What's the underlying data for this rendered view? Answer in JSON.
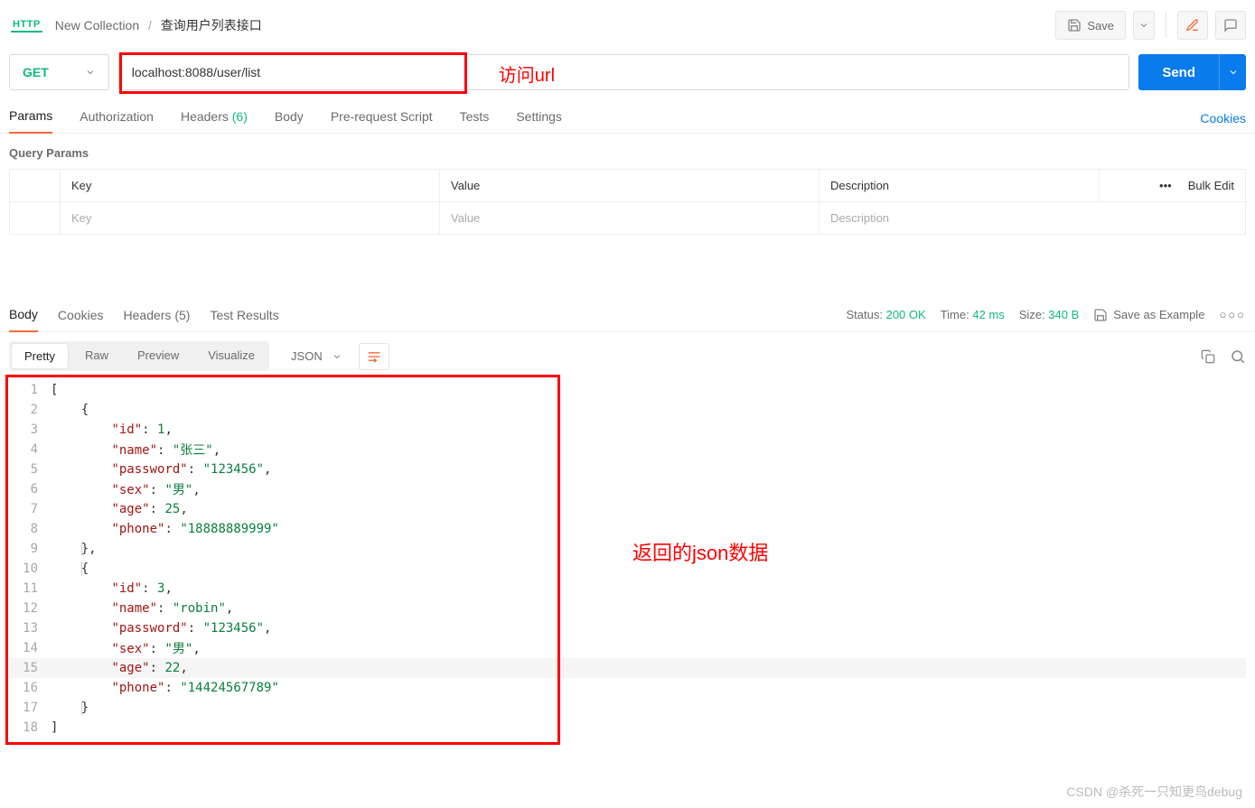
{
  "breadcrumb": {
    "collection": "New Collection",
    "request": "查询用户列表接口"
  },
  "top_actions": {
    "save": "Save"
  },
  "request": {
    "method": "GET",
    "url": "localhost:8088/user/list",
    "send": "Send"
  },
  "annotations": {
    "url_label": "访问url",
    "json_label": "返回的json数据"
  },
  "req_tabs": {
    "params": "Params",
    "authorization": "Authorization",
    "headers": "Headers",
    "headers_count": "(6)",
    "body": "Body",
    "prereq": "Pre-request Script",
    "tests": "Tests",
    "settings": "Settings",
    "cookies": "Cookies"
  },
  "query_params": {
    "title": "Query Params",
    "key_h": "Key",
    "value_h": "Value",
    "desc_h": "Description",
    "key_ph": "Key",
    "value_ph": "Value",
    "desc_ph": "Description",
    "bulk_edit": "Bulk Edit"
  },
  "resp_tabs": {
    "body": "Body",
    "cookies": "Cookies",
    "headers": "Headers",
    "headers_count": "(5)",
    "tests": "Test Results"
  },
  "resp_meta": {
    "status_l": "Status:",
    "status_v": "200 OK",
    "time_l": "Time:",
    "time_v": "42 ms",
    "size_l": "Size:",
    "size_v": "340 B",
    "save_example": "Save as Example"
  },
  "view": {
    "pretty": "Pretty",
    "raw": "Raw",
    "preview": "Preview",
    "visualize": "Visualize",
    "fmt": "JSON"
  },
  "json_lines": [
    {
      "ln": 1,
      "i": 0,
      "t": [
        [
          "br",
          "["
        ]
      ]
    },
    {
      "ln": 2,
      "i": 1,
      "t": [
        [
          "br",
          "{"
        ]
      ]
    },
    {
      "ln": 3,
      "i": 2,
      "t": [
        [
          "k",
          "\"id\""
        ],
        [
          "p",
          ": "
        ],
        [
          "n",
          "1"
        ],
        [
          "p",
          ","
        ]
      ]
    },
    {
      "ln": 4,
      "i": 2,
      "t": [
        [
          "k",
          "\"name\""
        ],
        [
          "p",
          ": "
        ],
        [
          "s",
          "\"张三\""
        ],
        [
          "p",
          ","
        ]
      ]
    },
    {
      "ln": 5,
      "i": 2,
      "t": [
        [
          "k",
          "\"password\""
        ],
        [
          "p",
          ": "
        ],
        [
          "s",
          "\"123456\""
        ],
        [
          "p",
          ","
        ]
      ]
    },
    {
      "ln": 6,
      "i": 2,
      "t": [
        [
          "k",
          "\"sex\""
        ],
        [
          "p",
          ": "
        ],
        [
          "s",
          "\"男\""
        ],
        [
          "p",
          ","
        ]
      ]
    },
    {
      "ln": 7,
      "i": 2,
      "t": [
        [
          "k",
          "\"age\""
        ],
        [
          "p",
          ": "
        ],
        [
          "n",
          "25"
        ],
        [
          "p",
          ","
        ]
      ]
    },
    {
      "ln": 8,
      "i": 2,
      "t": [
        [
          "k",
          "\"phone\""
        ],
        [
          "p",
          ": "
        ],
        [
          "s",
          "\"18888889999\""
        ]
      ]
    },
    {
      "ln": 9,
      "i": 1,
      "t": [
        [
          "br",
          "}"
        ],
        [
          "p",
          ","
        ]
      ],
      "box": true
    },
    {
      "ln": 10,
      "i": 1,
      "t": [
        [
          "br",
          "{"
        ]
      ],
      "box": true
    },
    {
      "ln": 11,
      "i": 2,
      "t": [
        [
          "k",
          "\"id\""
        ],
        [
          "p",
          ": "
        ],
        [
          "n",
          "3"
        ],
        [
          "p",
          ","
        ]
      ]
    },
    {
      "ln": 12,
      "i": 2,
      "t": [
        [
          "k",
          "\"name\""
        ],
        [
          "p",
          ": "
        ],
        [
          "s",
          "\"robin\""
        ],
        [
          "p",
          ","
        ]
      ]
    },
    {
      "ln": 13,
      "i": 2,
      "t": [
        [
          "k",
          "\"password\""
        ],
        [
          "p",
          ": "
        ],
        [
          "s",
          "\"123456\""
        ],
        [
          "p",
          ","
        ]
      ]
    },
    {
      "ln": 14,
      "i": 2,
      "t": [
        [
          "k",
          "\"sex\""
        ],
        [
          "p",
          ": "
        ],
        [
          "s",
          "\"男\""
        ],
        [
          "p",
          ","
        ]
      ]
    },
    {
      "ln": 15,
      "i": 2,
      "t": [
        [
          "k",
          "\"age\""
        ],
        [
          "p",
          ": "
        ],
        [
          "n",
          "22"
        ],
        [
          "p",
          ","
        ]
      ],
      "hl": true
    },
    {
      "ln": 16,
      "i": 2,
      "t": [
        [
          "k",
          "\"phone\""
        ],
        [
          "p",
          ": "
        ],
        [
          "s",
          "\"14424567789\""
        ]
      ]
    },
    {
      "ln": 17,
      "i": 1,
      "t": [
        [
          "br",
          "}"
        ]
      ],
      "box": true
    },
    {
      "ln": 18,
      "i": 0,
      "t": [
        [
          "br",
          "]"
        ]
      ]
    }
  ],
  "watermark": "CSDN @杀死一只知更鸟debug"
}
